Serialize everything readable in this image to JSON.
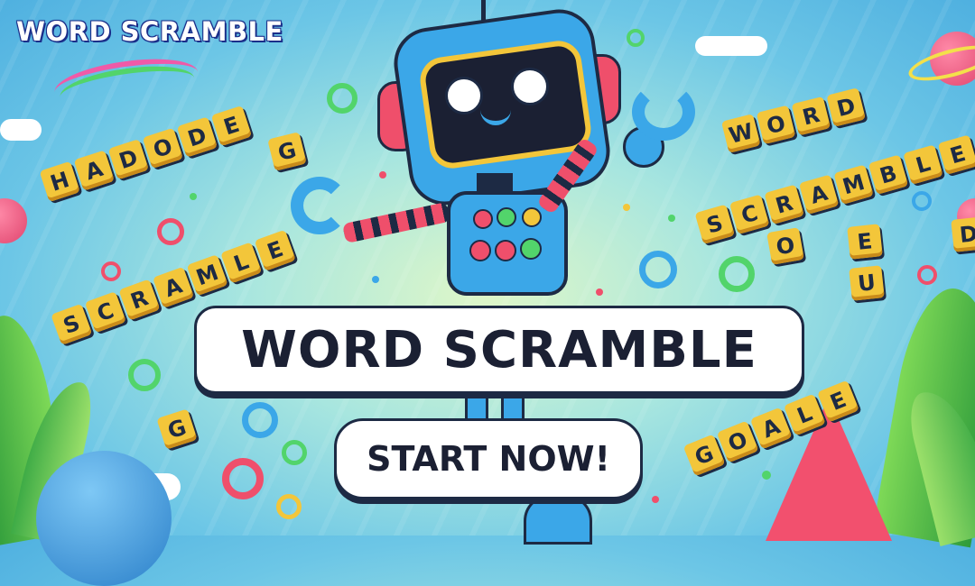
{
  "corner_title": "WORD SCRAMBLE",
  "banner_title": "WORD SCRAMBLE",
  "start_button_label": "START NOW!",
  "tiles": {
    "left_top": "HADODE",
    "left_mid": "SCRAMLE",
    "right_top_1": "WORD",
    "right_top_2": "SCRAMBLE",
    "right_bottom": "GOALE"
  },
  "colors": {
    "tile": "#f3c63a",
    "robot_body": "#3ba7e8",
    "accent_pink": "#ef4f6b",
    "banner": "#ffffff",
    "text_dark": "#1b2033"
  }
}
